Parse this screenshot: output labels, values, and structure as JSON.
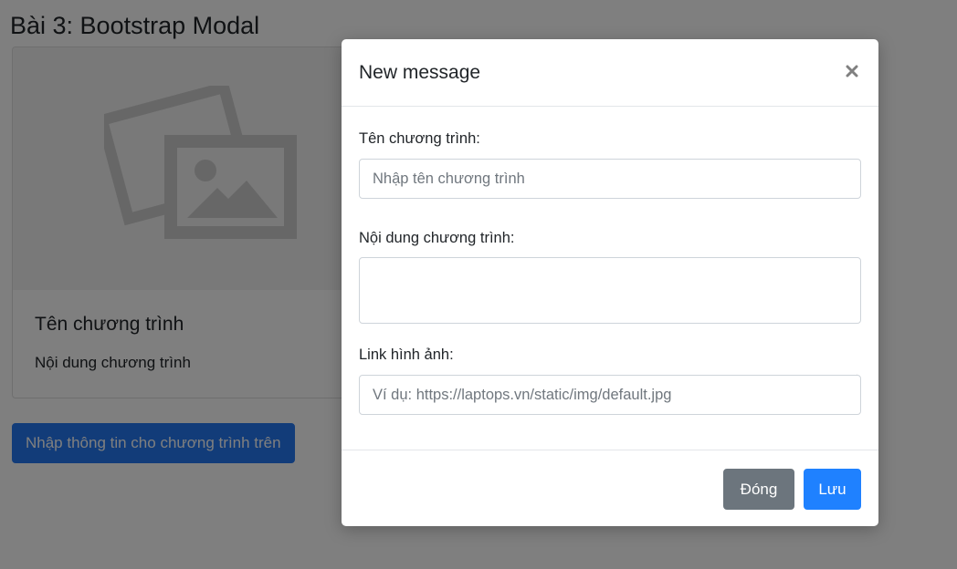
{
  "page": {
    "title": "Bài 3: Bootstrap Modal"
  },
  "card": {
    "image_icon": "image-placeholder-icon",
    "title": "Tên chương trình",
    "text": "Nội dung chương trình"
  },
  "open_button": {
    "label": "Nhập thông tin cho chương trình trên"
  },
  "modal": {
    "title": "New message",
    "close_label": "×",
    "fields": [
      {
        "label": "Tên chương trình:",
        "placeholder": "Nhập tên chương trình",
        "value": ""
      },
      {
        "label": "Nội dung chương trình:",
        "placeholder": "",
        "value": ""
      },
      {
        "label": "Link hình ảnh:",
        "placeholder": "Ví dụ: https://laptops.vn/static/img/default.jpg",
        "value": ""
      }
    ],
    "buttons": {
      "close": "Đóng",
      "save": "Lưu"
    }
  },
  "colors": {
    "primary": "#1f81ff",
    "secondary": "#6c757d",
    "backdrop": "rgba(0,0,0,0.5)"
  }
}
